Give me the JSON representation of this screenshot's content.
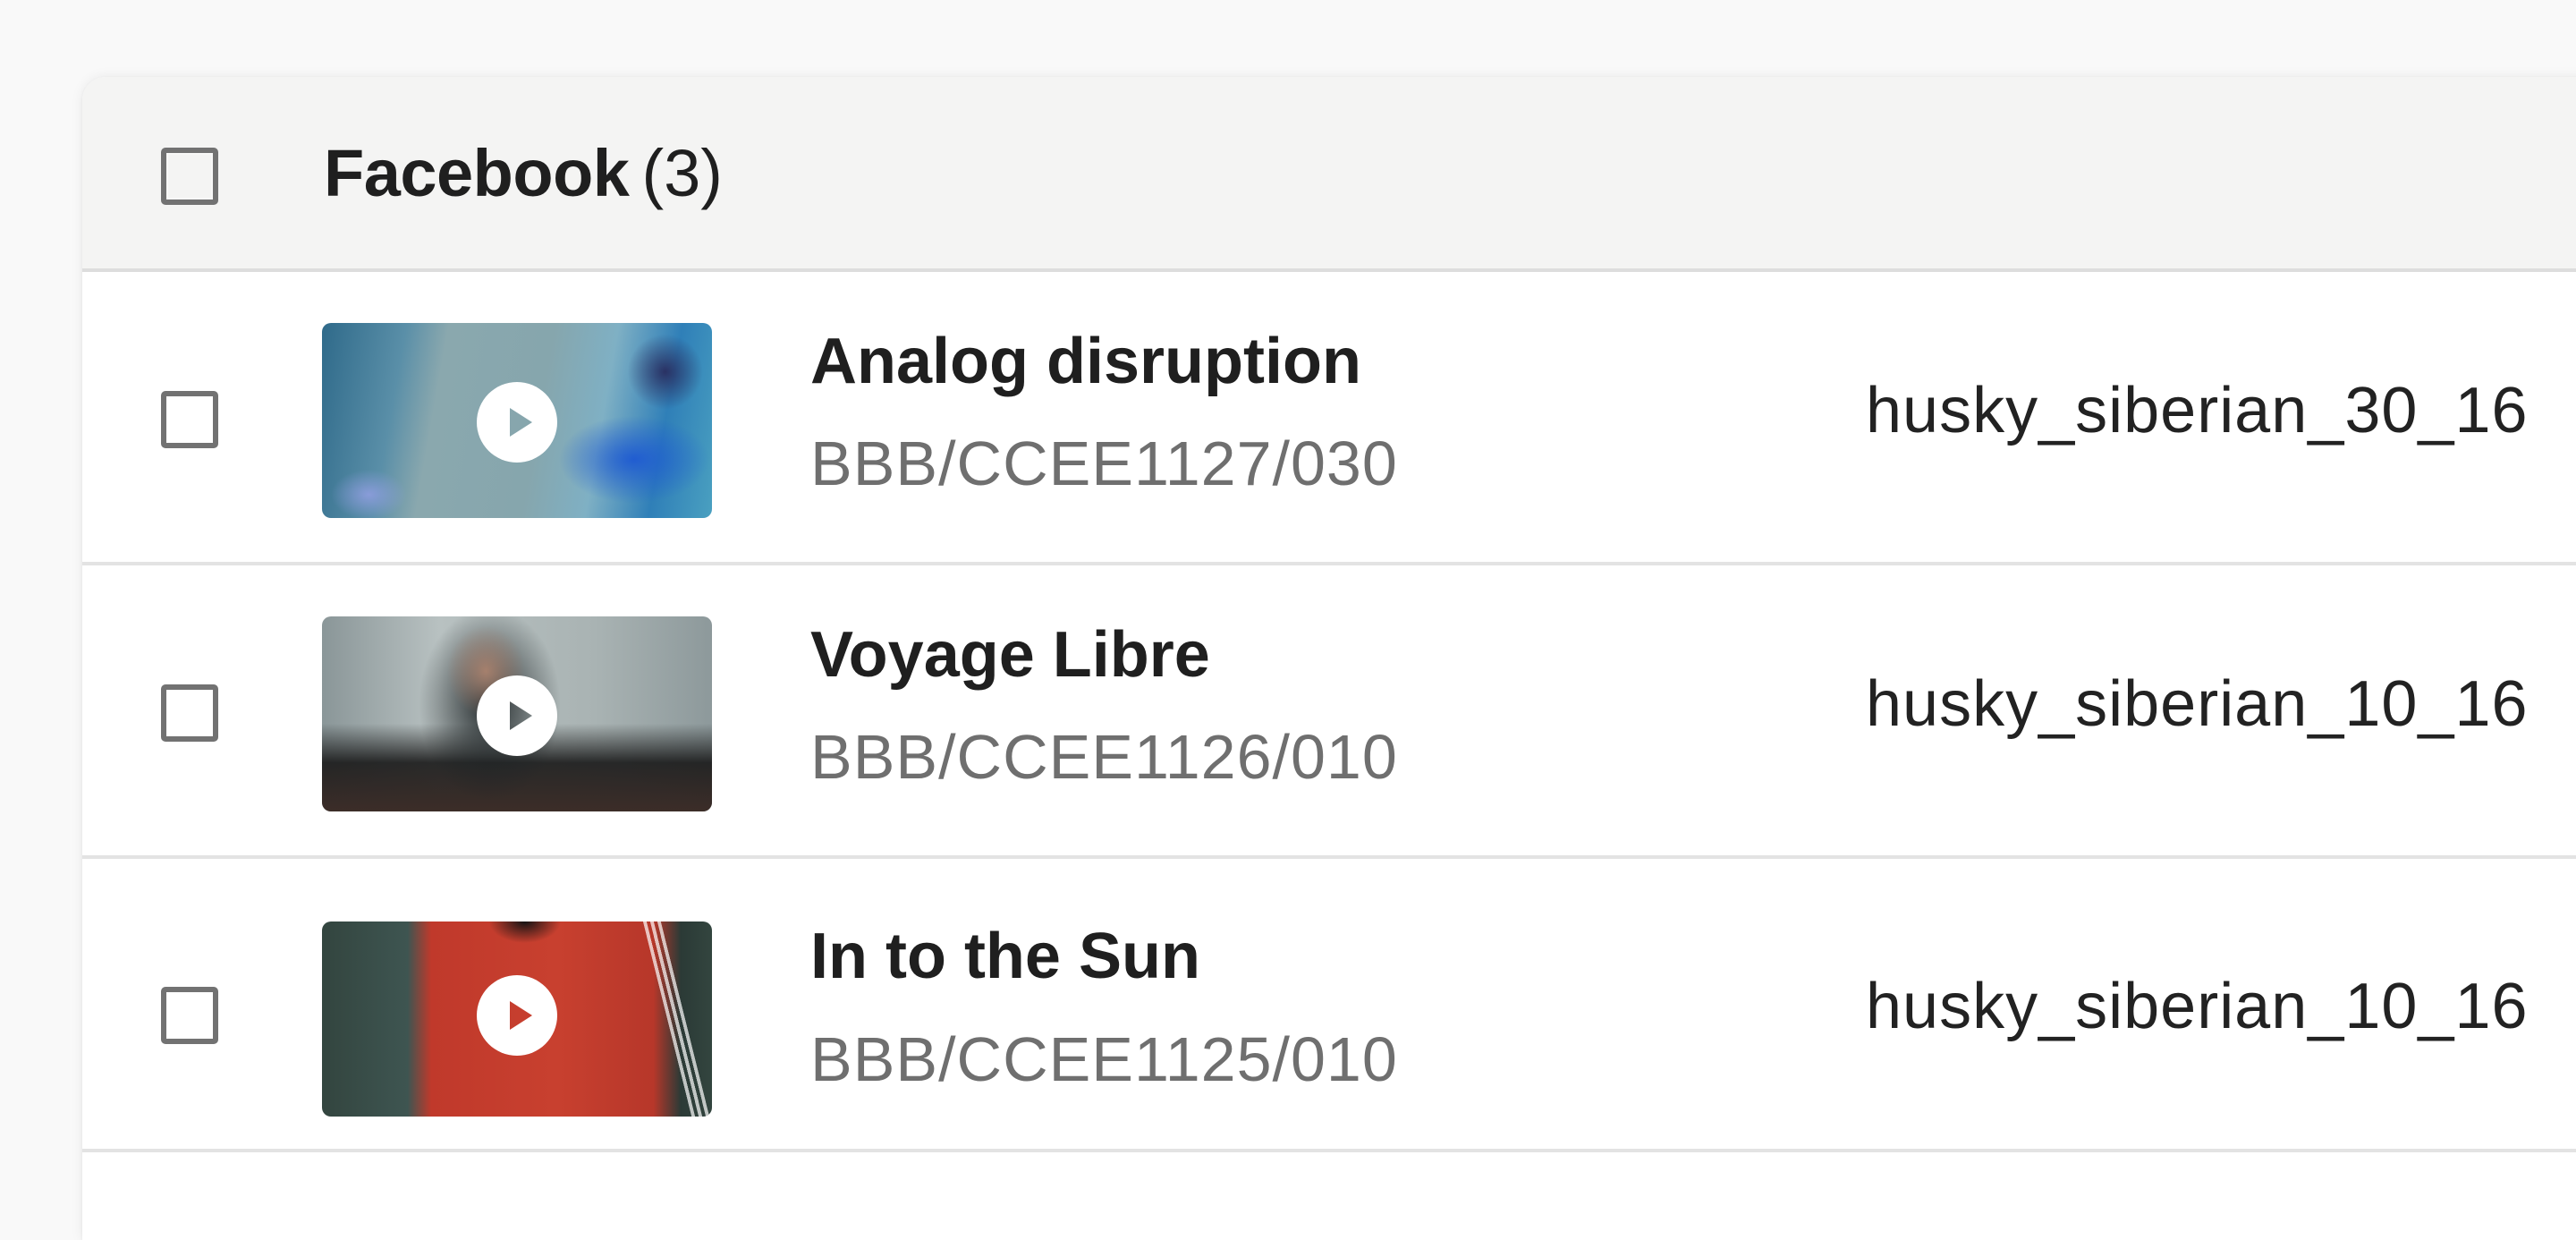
{
  "group": {
    "name": "Facebook",
    "count": "(3)",
    "select_all_checked": false
  },
  "rows": [
    {
      "title": "Analog disruption",
      "code": "BBB/CCEE1127/030",
      "filename": "husky_siberian_30_16",
      "thumbnail": "sneaker-video-thumbnail",
      "checked": false
    },
    {
      "title": "Voyage Libre",
      "code": "BBB/CCEE1126/010",
      "filename": "husky_siberian_10_16",
      "thumbnail": "drone-man-video-thumbnail",
      "checked": false
    },
    {
      "title": "In to the Sun",
      "code": "BBB/CCEE1125/010",
      "filename": "husky_siberian_10_16",
      "thumbnail": "red-shirt-video-thumbnail",
      "checked": false
    }
  ],
  "colors": {
    "page_bg": "#f9f9f9",
    "header_bg": "#f4f4f3",
    "text_primary": "#1f1f1f",
    "text_secondary": "#6f6f6f",
    "checkbox_border": "#727272",
    "divider": "#e3e3e3"
  },
  "icons": {
    "play": "play-icon",
    "checkbox": "checkbox-unchecked-icon"
  }
}
